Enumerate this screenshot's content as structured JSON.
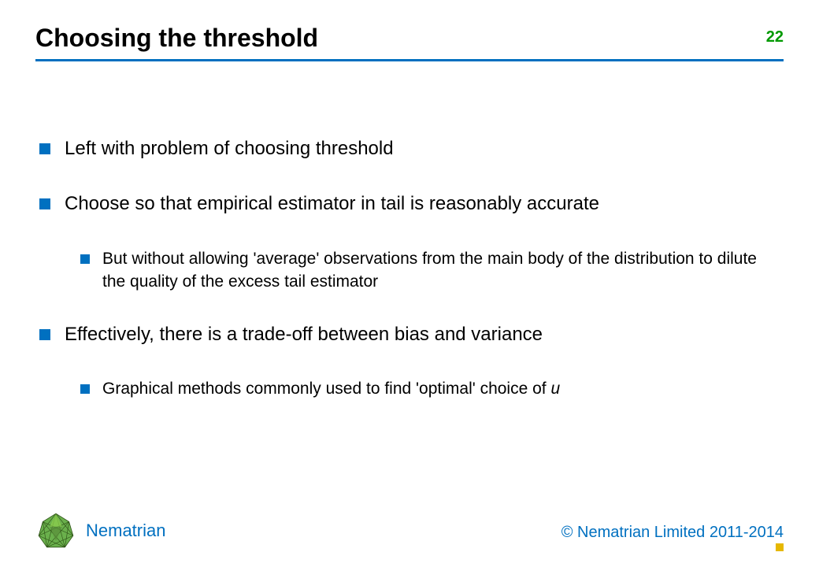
{
  "header": {
    "title": "Choosing the threshold",
    "page_number": "22"
  },
  "content": {
    "bullets": [
      {
        "level": 1,
        "text": "Left with problem of choosing threshold"
      },
      {
        "level": 1,
        "text": "Choose so that empirical estimator in tail is reasonably accurate"
      },
      {
        "level": 2,
        "text": "But without allowing 'average' observations from the main body of the distribution to dilute the quality of the excess tail estimator"
      },
      {
        "level": 1,
        "text": "Effectively, there is a trade-off between bias and variance"
      },
      {
        "level": 2,
        "text_prefix": "Graphical methods commonly used to find 'optimal' choice of ",
        "text_italic": "u"
      }
    ]
  },
  "footer": {
    "brand": "Nematrian",
    "copyright": "© Nematrian Limited 2011-2014"
  },
  "colors": {
    "accent_blue": "#0070c0",
    "accent_green": "#009900",
    "accent_yellow": "#e6b800"
  }
}
